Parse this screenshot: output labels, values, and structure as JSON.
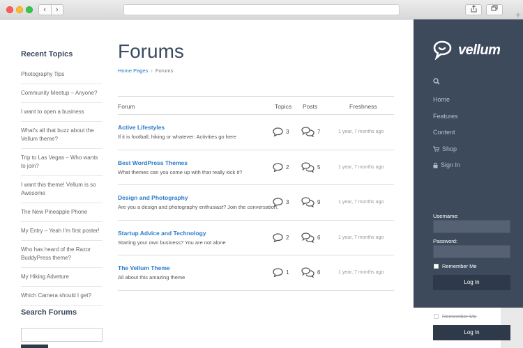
{
  "browser": {
    "back": "‹",
    "forward": "›",
    "plus": "+"
  },
  "sidebar": {
    "recent_title": "Recent Topics",
    "recent_topics": [
      "Photography Tips",
      "Community Meetup – Anyone?",
      "I want to open a business",
      "What's all that buzz about the Vellum theme?",
      "Trip to Las Vegas – Who wants to join?",
      "I want this theme! Vellum is so Awesome",
      "The New Pineapple Phone",
      "My Entry – Yeah I'm first poster!",
      "Who has heard of the Razor BuddyPress theme?",
      "My Hiking Adveture",
      "Which Camera should I get?"
    ],
    "search_title": "Search Forums"
  },
  "main": {
    "title": "Forums",
    "breadcrumb": {
      "home": "Home Pages",
      "separator": "›",
      "current": "Forums"
    },
    "columns": {
      "forum": "Forum",
      "topics": "Topics",
      "posts": "Posts",
      "freshness": "Freshness"
    },
    "forums": [
      {
        "title": "Active Lifestyles",
        "desc": "If it is football, hiking or whatever: Activities go here",
        "topics": "3",
        "posts": "7",
        "fresh": "1 year, 7 months ago"
      },
      {
        "title": "Best WordPress Themes",
        "desc": "What themes can you come up with that really kick it?",
        "topics": "2",
        "posts": "5",
        "fresh": "1 year, 7 months ago"
      },
      {
        "title": "Design and Photography",
        "desc": "Are you a design and photography enthusiast? Join the conversation.",
        "topics": "3",
        "posts": "9",
        "fresh": "1 year, 7 months ago"
      },
      {
        "title": "Startup Advice and Technology",
        "desc": "Starting your own business? You are not alone",
        "topics": "2",
        "posts": "6",
        "fresh": "1 year, 7 months ago"
      },
      {
        "title": "The Vellum Theme",
        "desc": "All about this amazing theme",
        "topics": "1",
        "posts": "6",
        "fresh": "1 year, 7 months ago"
      }
    ]
  },
  "right": {
    "logo": "vellum",
    "menu": [
      "Home",
      "Features",
      "Content",
      "Shop",
      "Sign In"
    ],
    "username_label": "Username:",
    "password_label": "Password:",
    "remember": "Remember Me",
    "login": "Log In",
    "remember2": "Remember Me",
    "login2": "Log In"
  },
  "colors": {
    "accent": "#2a7ac7",
    "sidebar_bg": "#3d4a5c",
    "heading": "#3b4a5e"
  },
  "icons": [
    "share-icon",
    "tabs-icon",
    "chat-bubble-icon",
    "chat-bubbles-icon",
    "search-icon",
    "cart-icon",
    "lock-icon"
  ]
}
